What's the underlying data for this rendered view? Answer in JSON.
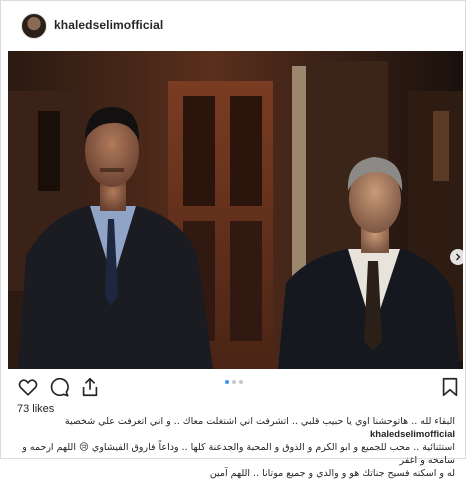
{
  "post": {
    "username": "khaledselimofficial",
    "likes_text": "73 likes",
    "caption_username": "khaledselimofficial",
    "caption_lines": [
      "البقاء لله .. هاتوحشنا اوي يا حبيب قلبي .. اتشرفت اني اشتغلت معاك .. و اني اتعرفت علي شخصية",
      "استثنائية .. محب للجميع و ابو الكرم و الذوق و المحبة والجدعنة كلها .. وداعاً فاروق الفيشاوي 😢 اللهم ارحمه و سامحه و اغفر",
      "له و اسكنه فسيح جناتك هو و والدي و جميع موتانا .. اللهم آمين"
    ],
    "carousel": {
      "count": 3,
      "active_index": 0
    }
  },
  "icons": {
    "header": "avatar",
    "actions": [
      "heart-icon",
      "comment-icon",
      "share-icon"
    ],
    "save": "bookmark-icon",
    "carousel_next": "chevron-right-icon"
  },
  "colors": {
    "text": "#262626",
    "border": "#dbdbdb",
    "active_dot": "#3897f0",
    "inactive_dot": "#c8c8c8"
  }
}
